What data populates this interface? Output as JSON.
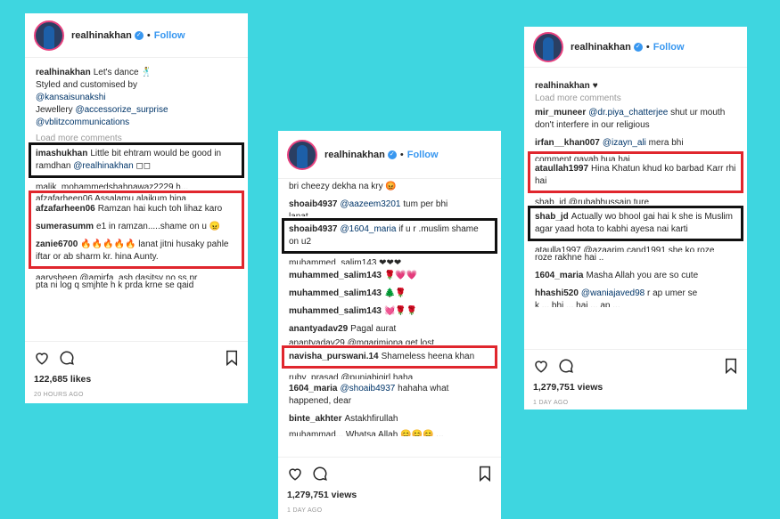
{
  "left": {
    "username": "realhinakhan",
    "follow": "Follow",
    "caption_user": "realhinakhan",
    "caption_text": "Let's dance 🕺",
    "caption_lines": [
      "Styled and customised by"
    ],
    "mention1": "@kansaisunakshi",
    "jewellery_label": "Jewellery",
    "mention2": "@accessorize_surprise",
    "mention3": "@vblitzcommunications",
    "load_more": "Load more comments",
    "boxed_comment": {
      "user": "imashukhan",
      "text": "Little bit ehtram would be good in ramdhan",
      "mention": "@realhinakhan",
      "emoji": "◻◻"
    },
    "cut1": "malik_mohammedshahnawaz2229 h...",
    "cut2": "afzafarheen06 Assalamu alaikum hina",
    "red_comments": [
      {
        "user": "afzafarheen06",
        "text": "Ramzan hai kuch toh lihaz karo"
      },
      {
        "user": "sumerasumm",
        "text": "e1 in ramzan.....shame on u 😠"
      },
      {
        "user": "zanie6700",
        "text": "🔥🔥🔥🔥🔥 lanat jitni husaky pahle iftar or ab sharm kr. hina Aunty."
      }
    ],
    "cut3": "aarvsheen @amirfa_ash dasitsy no ss pr",
    "after": "pta ni log q smjhte h k prda krne se qaid",
    "likes": "122,685 likes",
    "time": "20 HOURS AGO"
  },
  "mid": {
    "username": "realhinakhan",
    "follow": "Follow",
    "top_text": "bri cheezy dekha na kry 😡",
    "c1_user": "shoaib4937",
    "c1_mention": "@aazeem3201",
    "c1_text": "tum per bhi",
    "c1_cut": "lanat",
    "boxed_comment": {
      "user": "shoaib4937",
      "mention": "@1604_maria",
      "text": "if u r .muslim shame on u2"
    },
    "cut1": "muhammed_salim143 ❤❤❤",
    "comments": [
      {
        "user": "muhammed_salim143",
        "text": "🌹💗💗"
      },
      {
        "user": "muhammed_salim143",
        "text": "🌲🌹"
      },
      {
        "user": "muhammed_salim143",
        "text": "💓🌹🌹"
      },
      {
        "user": "anantyadav29",
        "text": "Pagal aurat"
      }
    ],
    "cut2": "anantyadav29 @mgarimiona get lost",
    "red_comment": {
      "user": "navisha_purswani.14",
      "text": "Shameless heena khan"
    },
    "cut3": "ruby_prasad @punjabigirl haha",
    "c2_user": "1604_maria",
    "c2_mention": "@shoaib4937",
    "c2_text": "hahaha what happened, dear",
    "c3_user": "binte_akhter",
    "c3_text": "Astakhfirullah",
    "cut4": "muhammad... Whatsa Allah 😊😊😊 ...",
    "views": "1,279,751 views",
    "time": "1 DAY AGO"
  },
  "right": {
    "username": "realhinakhan",
    "follow": "Follow",
    "caption_user": "realhinakhan",
    "caption_text": "♥",
    "load_more": "Load more comments",
    "c1_user": "mir_muneer",
    "c1_mention": "@dr.piya_chatterjee",
    "c1_text": "shut ur mouth don't interfere in our religious",
    "c2_user": "irfan__khan007",
    "c2_mention": "@izayn_ali",
    "c2_text": "mera bhi",
    "cut1": "comment gayab hua hai",
    "red_comment": {
      "user": "ataullah1997",
      "text": "Hina Khatun khud ko barbad Karr rhi hai"
    },
    "cut2": "shab_jd @rubabhussain ture",
    "boxed_comment": {
      "user": "shab_jd",
      "text": "Actually wo bhool gai hai k she is Muslim agar yaad hota to kabhi ayesa nai karti"
    },
    "cut3": "ataulla1997 @azaarim.cand1991 she ko roze",
    "after": "roze rakhne hai ..",
    "c3_user": "1604_maria",
    "c3_text": "Masha Allah you are so cute",
    "c4_user": "hhashi520",
    "c4_mention": "@waniajaved98",
    "c4_text": "r ap umer se",
    "cut4": "k ... bhi ... hai ... ap ...",
    "views": "1,279,751 views",
    "time": "1 DAY AGO"
  },
  "colors": {
    "background": "#3ed6e0",
    "red_box": "#e0262d",
    "black_box": "#111111",
    "link": "#3897f0"
  }
}
